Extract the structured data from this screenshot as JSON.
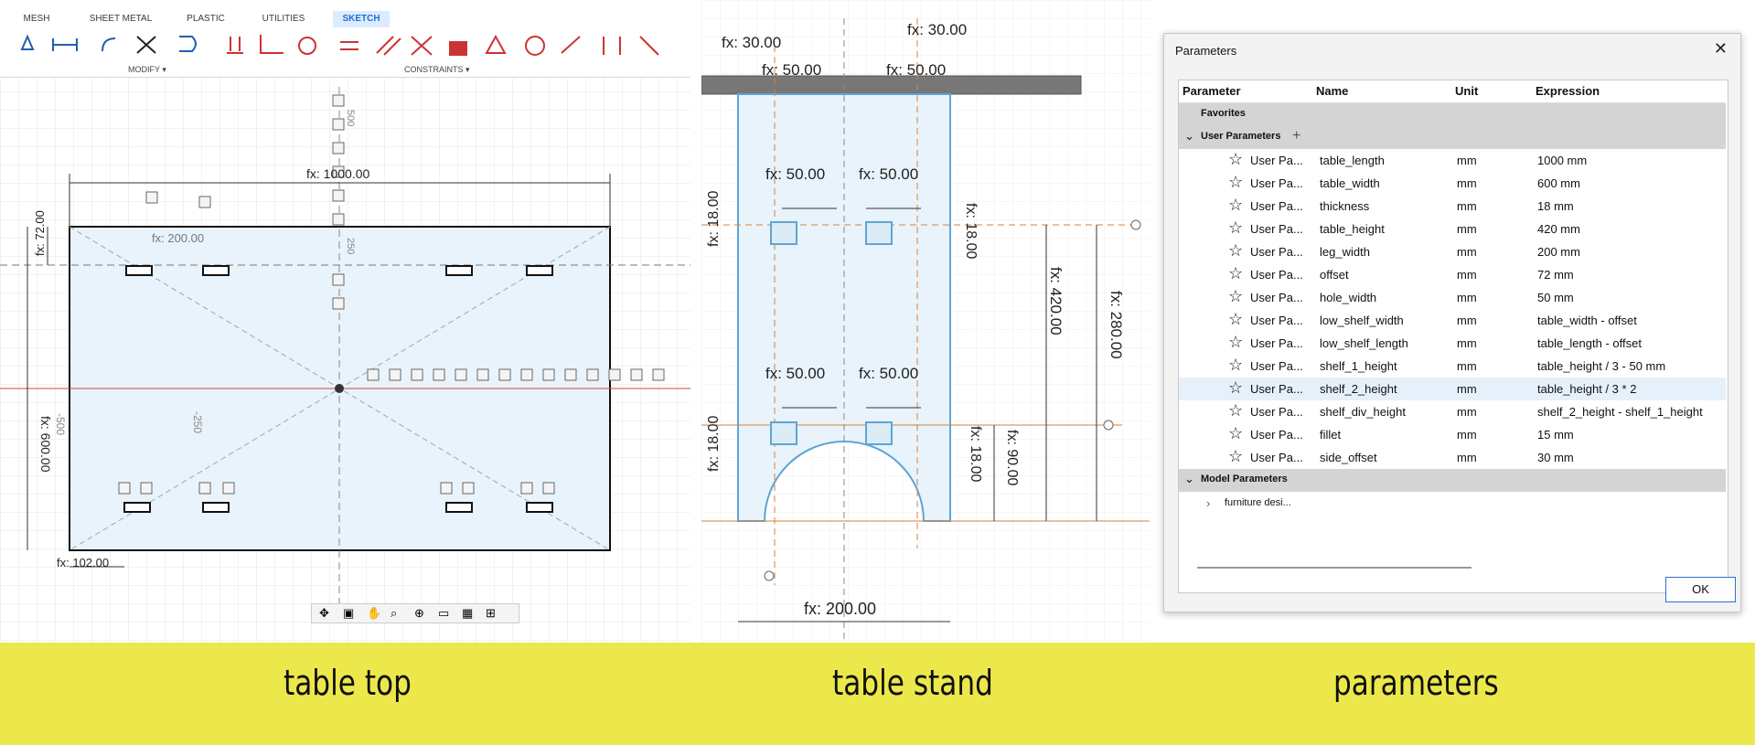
{
  "captions": {
    "table_top": "table top",
    "table_stand": "table stand",
    "parameters": "parameters"
  },
  "toolbar": {
    "tabs": [
      "MESH",
      "SHEET METAL",
      "PLASTIC",
      "UTILITIES",
      "SKETCH"
    ],
    "active_tab": "SKETCH",
    "groups": {
      "modify": "MODIFY ▾",
      "constraints": "CONSTRAINTS ▾"
    }
  },
  "table_top": {
    "dims": {
      "length": "fx: 1000.00",
      "offset_top": "fx: 72.00",
      "width": "fx: 600.00",
      "bottom_left": "fx: 102.00",
      "inner": "fx: 200.00"
    },
    "axis_labels": [
      "500",
      "250",
      "-250",
      "-500"
    ]
  },
  "table_stand": {
    "dims": {
      "top_left": "fx: 30.00",
      "top_right": "fx: 30.00",
      "top_left_b": "fx: 50.00",
      "top_right_b": "fx: 50.00",
      "hole_a1": "fx: 50.00",
      "hole_a2": "fx: 50.00",
      "hole_b1": "fx: 50.00",
      "hole_b2": "fx: 50.00",
      "thk1_l": "fx: 18.00",
      "thk1_r": "fx: 18.00",
      "thk2_l": "fx: 18.00",
      "thk2_r": "fx: 18.00",
      "height": "fx: 420.00",
      "shelf": "fx: 280.00",
      "low": "fx: 90.00",
      "width": "fx: 200.00"
    }
  },
  "dialog": {
    "title": "Parameters",
    "close": "✕",
    "columns": [
      "Parameter",
      "Name",
      "Unit",
      "Expression"
    ],
    "favorites": "Favorites",
    "user_group": "User Parameters",
    "model_group": "Model Parameters",
    "model_item": "furniture desi...",
    "ok": "OK",
    "rows": [
      {
        "param": "User Pa...",
        "name": "table_length",
        "unit": "mm",
        "expr": "1000 mm"
      },
      {
        "param": "User Pa...",
        "name": "table_width",
        "unit": "mm",
        "expr": "600 mm"
      },
      {
        "param": "User Pa...",
        "name": "thickness",
        "unit": "mm",
        "expr": "18 mm"
      },
      {
        "param": "User Pa...",
        "name": "table_height",
        "unit": "mm",
        "expr": "420 mm"
      },
      {
        "param": "User Pa...",
        "name": "leg_width",
        "unit": "mm",
        "expr": "200 mm"
      },
      {
        "param": "User Pa...",
        "name": "offset",
        "unit": "mm",
        "expr": "72 mm"
      },
      {
        "param": "User Pa...",
        "name": "hole_width",
        "unit": "mm",
        "expr": "50 mm"
      },
      {
        "param": "User Pa...",
        "name": "low_shelf_width",
        "unit": "mm",
        "expr": "table_width - offset"
      },
      {
        "param": "User Pa...",
        "name": "low_shelf_length",
        "unit": "mm",
        "expr": "table_length - offset"
      },
      {
        "param": "User Pa...",
        "name": "shelf_1_height",
        "unit": "mm",
        "expr": "table_height / 3 - 50 mm"
      },
      {
        "param": "User Pa...",
        "name": "shelf_2_height",
        "unit": "mm",
        "expr": "table_height / 3 * 2"
      },
      {
        "param": "User Pa...",
        "name": "shelf_div_height",
        "unit": "mm",
        "expr": "shelf_2_height - shelf_1_height"
      },
      {
        "param": "User Pa...",
        "name": "fillet",
        "unit": "mm",
        "expr": "15 mm"
      },
      {
        "param": "User Pa...",
        "name": "side_offset",
        "unit": "mm",
        "expr": "30 mm"
      }
    ]
  }
}
